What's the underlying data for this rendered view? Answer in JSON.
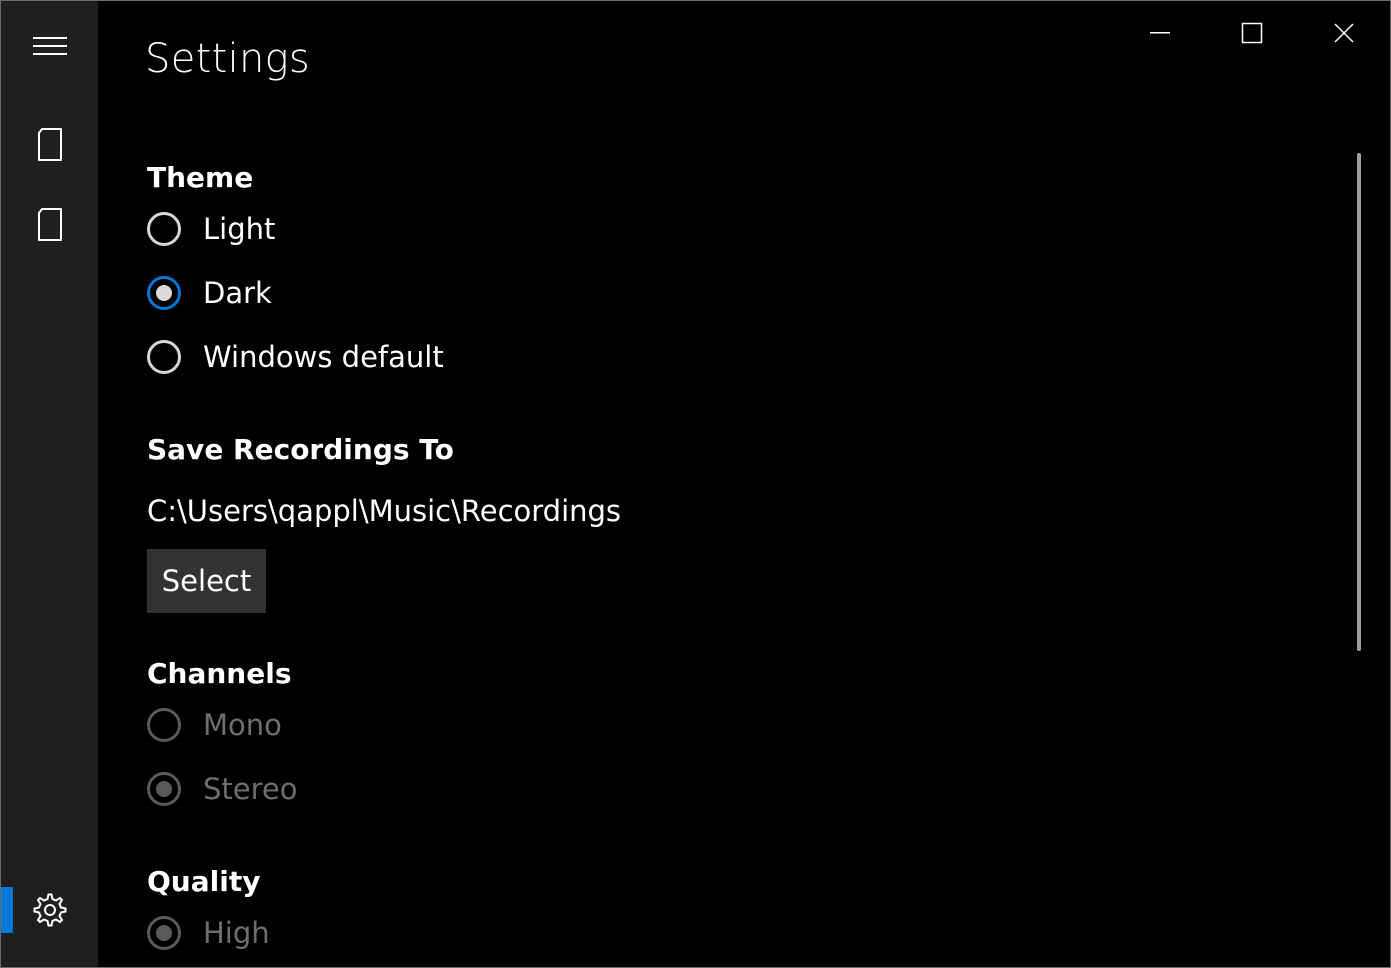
{
  "window": {
    "title": "Settings",
    "caption_buttons": [
      "minimize",
      "maximize",
      "close"
    ]
  },
  "sidebar": {
    "items": [
      {
        "icon": "hamburger-menu-icon"
      },
      {
        "icon": "recording-page-icon"
      },
      {
        "icon": "recordings-list-icon"
      },
      {
        "icon": "gear-icon",
        "selected": true
      }
    ],
    "accent_color": "#0078d7"
  },
  "sections": {
    "theme": {
      "header": "Theme",
      "options": [
        {
          "label": "Light",
          "checked": false
        },
        {
          "label": "Dark",
          "checked": true
        },
        {
          "label": "Windows default",
          "checked": false
        }
      ]
    },
    "save": {
      "header": "Save Recordings To",
      "path": "C:\\Users\\qappl\\Music\\Recordings",
      "button_label": "Select"
    },
    "channels": {
      "header": "Channels",
      "options": [
        {
          "label": "Mono",
          "checked": false,
          "disabled": true
        },
        {
          "label": "Stereo",
          "checked": true,
          "disabled": true
        }
      ]
    },
    "quality": {
      "header": "Quality",
      "options": [
        {
          "label": "High",
          "checked": true,
          "disabled": true
        }
      ]
    }
  }
}
